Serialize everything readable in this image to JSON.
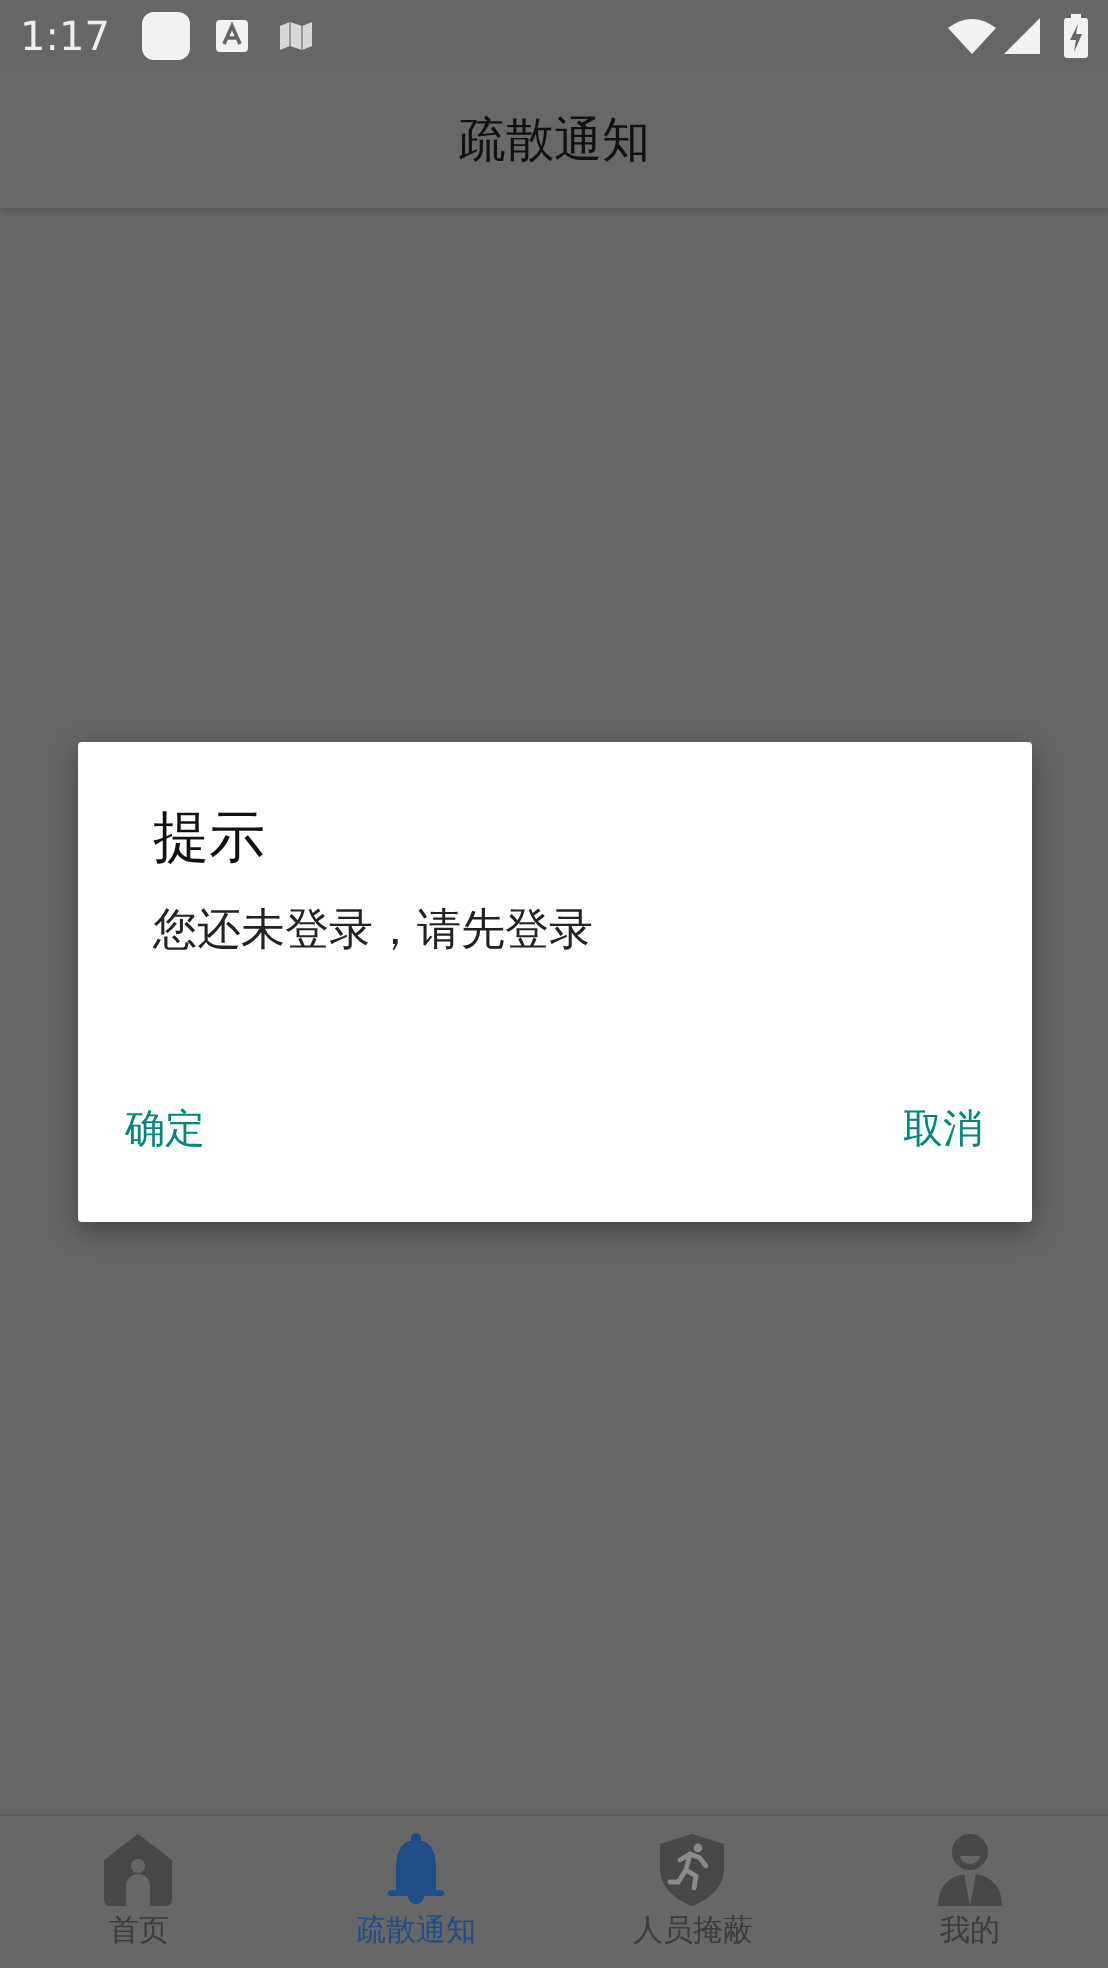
{
  "status_bar": {
    "time": "1:17"
  },
  "header": {
    "title": "疏散通知"
  },
  "dialog": {
    "title": "提示",
    "message": "您还未登录，请先登录",
    "buttons": [
      "确定",
      "取消"
    ]
  },
  "tab_bar": [
    {
      "label": "首页",
      "kind": "home",
      "selected": false
    },
    {
      "label": "疏散通知",
      "kind": "bell",
      "selected": true
    },
    {
      "label": "人员掩蔽",
      "kind": "shield",
      "selected": false
    },
    {
      "label": "我的",
      "kind": "person",
      "selected": false
    }
  ]
}
